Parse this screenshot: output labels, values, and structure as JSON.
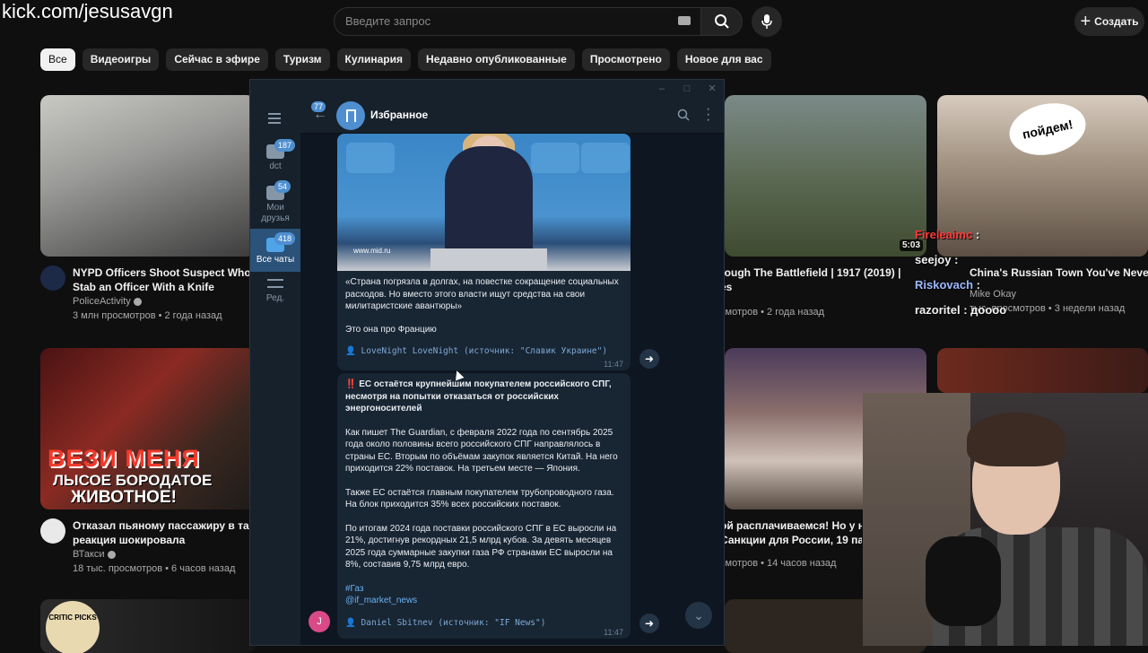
{
  "watermark": "kick.com/jesusavgn",
  "youtube": {
    "search_placeholder": "Введите запрос",
    "create_label": "Создать",
    "chips": [
      "Все",
      "Видеоигры",
      "Сейчас в эфире",
      "Туризм",
      "Кулинария",
      "Недавно опубликованные",
      "Просмотрено",
      "Новое для вас"
    ],
    "videos": [
      {
        "title1": "NYPD Officers Shoot Suspect Who A",
        "title2": "Stab an Officer With a Knife",
        "channel": "PoliceActivity",
        "meta": "3 млн просмотров • 2 года назад"
      },
      {
        "title1": "Отказал пьяному пассажиру в так",
        "title2": "реакция шокировала",
        "channel": "ВТакси",
        "meta": "18 тыс. просмотров • 6 часов назад"
      },
      {
        "title1": "rough The Battlefield | 1917 (2019) |",
        "title2": "es",
        "meta": "смотров • 2 года назад",
        "duration": "5:03"
      },
      {
        "title1": "China's Russian Town You've Never H",
        "channel": "Mike Okay",
        "meta": "тыс. просмотров • 3 недели назад"
      },
      {
        "title1": "ой расплачиваемся! Но у н",
        "title2": "Санкции для России, 19 пак",
        "meta": "смотров • 14 часов назад"
      }
    ],
    "thumb_text": {
      "big": "ВЕЗИ МЕНЯ",
      "line2": "ЛЫСОЕ БОРОДАТОЕ",
      "line3": "ЖИВОТНОЕ!",
      "bubble": "пойдем!",
      "badge": "CRITIC PICKS"
    }
  },
  "stream_chat": [
    {
      "user": "Fireleaimc",
      "text": ":",
      "color": "#ff3b3b"
    },
    {
      "user": "seejoy",
      "text": ":",
      "color": "#ffffff"
    },
    {
      "user": "Riskovach",
      "text": ":",
      "color": "#9bb8ff"
    },
    {
      "user": "razoritel",
      "text": ": дoooo",
      "color": "#ffffff"
    }
  ],
  "telegram": {
    "sidebar": [
      {
        "label": "dct",
        "badge": "187"
      },
      {
        "label": "Мои друзья",
        "badge": "54"
      },
      {
        "label": "Все чаты",
        "badge": "418"
      },
      {
        "label": "Ред."
      }
    ],
    "back_badge": "77",
    "chat_title": "Избранное",
    "message1": {
      "photo_url": "www.mid.ru",
      "quote": "«Страна погрязла в долгах, на повестке сокращение социальных расходов. Но вместо этого власти ищут средства на свои милитаристские авантюры»",
      "note": "Это она про Францию",
      "forward": "👤 LoveNight LoveNight (источник: \"Славик Украине\")",
      "time": "11:47"
    },
    "message2": {
      "headline": "‼️ ЕС остаётся крупнейшим покупателем российского СПГ, несмотря на попытки отказаться от российских энергоносителей",
      "p1": "Как пишет The Guardian, с февраля 2022 года по сентябрь 2025 года около половины всего российского СПГ направлялось в страны ЕС. Вторым по объёмам закупок является Китай. На него приходится 22% поставок. На третьем месте — Япония.",
      "p2": "Также ЕС остаётся главным покупателем трубопроводного газа. На блок приходится 35% всех российских поставок.",
      "p3": "По итогам 2024 года поставки российского СПГ в ЕС выросли на 21%, достигнув рекордных 21,5 млрд кубов. За девять месяцев 2025 года суммарные закупки газа РФ странами ЕС выросли на 8%, составив 9,75 млрд евро.",
      "tag": "#Газ",
      "channel": "@if_market_news",
      "forward": "👤 Daniel Sbitnev (источник: \"IF News\")",
      "time": "11:47"
    },
    "avatar_letter": "J"
  }
}
